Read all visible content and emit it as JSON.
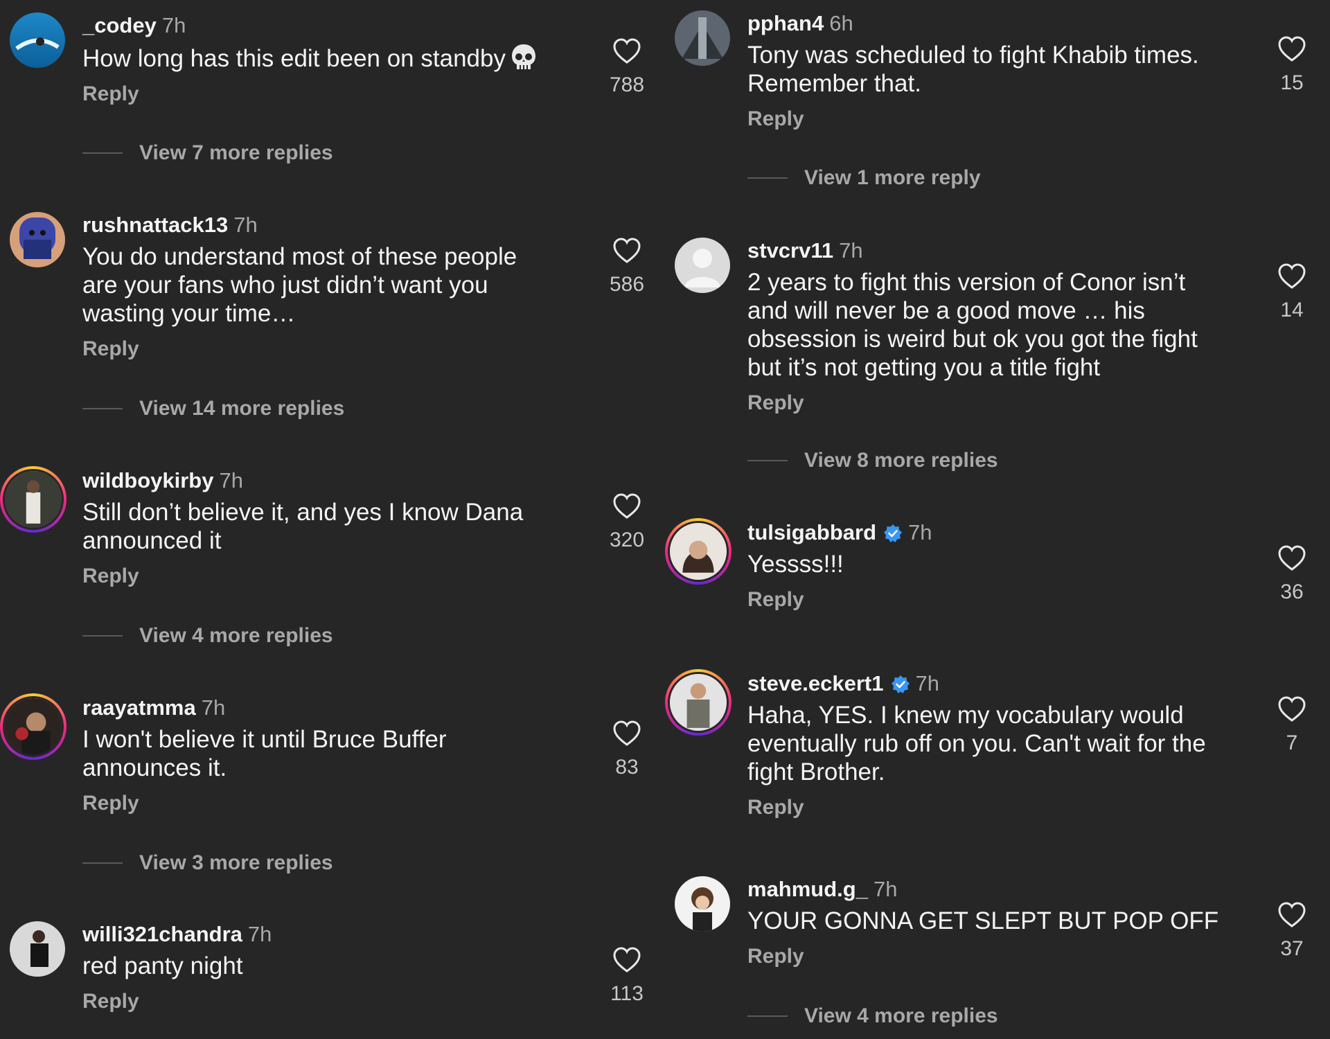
{
  "colors": {
    "background": "#262626",
    "text": "#f5f5f5",
    "muted": "#a8a8a8",
    "verified": "#3897f0"
  },
  "reply_label": "Reply",
  "left": [
    {
      "user": "_codey",
      "time": "7h",
      "text": "How long has this edit been on standby",
      "emoji": "skull",
      "likes": "788",
      "more": "View 7 more replies"
    },
    {
      "user": "rushnattack13",
      "time": "7h",
      "text": "You do understand most of these people\nare your fans who just didn’t want you\nwasting your time…",
      "likes": "586",
      "more": "View 14 more replies"
    },
    {
      "user": "wildboykirby",
      "time": "7h",
      "text": "Still don’t believe it, and yes I know Dana\nannounced it",
      "likes": "320",
      "more": "View 4 more replies"
    },
    {
      "user": "raayatmma",
      "time": "7h",
      "text": "I won't believe it until Bruce Buffer\nannounces it.",
      "likes": "83",
      "more": "View 3 more replies"
    },
    {
      "user": "willi321chandra",
      "time": "7h",
      "text": "red panty night",
      "likes": "113"
    }
  ],
  "right": [
    {
      "user": "pphan4",
      "time": "6h",
      "text": "Tony was scheduled to fight Khabib times.\nRemember that.",
      "likes": "15",
      "more": "View 1 more reply"
    },
    {
      "user": "stvcrv11",
      "time": "7h",
      "text": "2 years to fight this version of Conor isn’t\nand will never be a good move … his\nobsession is weird but ok you got the fight\nbut it’s not getting you a title fight",
      "likes": "14",
      "more": "View 8 more replies"
    },
    {
      "user": "tulsigabbard",
      "time": "7h",
      "verified": true,
      "text": "Yessss!!!",
      "likes": "36"
    },
    {
      "user": "steve.eckert1",
      "time": "7h",
      "verified": true,
      "text": "Haha, YES. I knew my vocabulary would\neventually rub off on you. Can't wait for the\nfight Brother.",
      "likes": "7"
    },
    {
      "user": "mahmud.g_",
      "time": "7h",
      "text": "YOUR GONNA GET SLEPT BUT POP OFF",
      "likes": "37",
      "more": "View 4 more replies"
    }
  ]
}
